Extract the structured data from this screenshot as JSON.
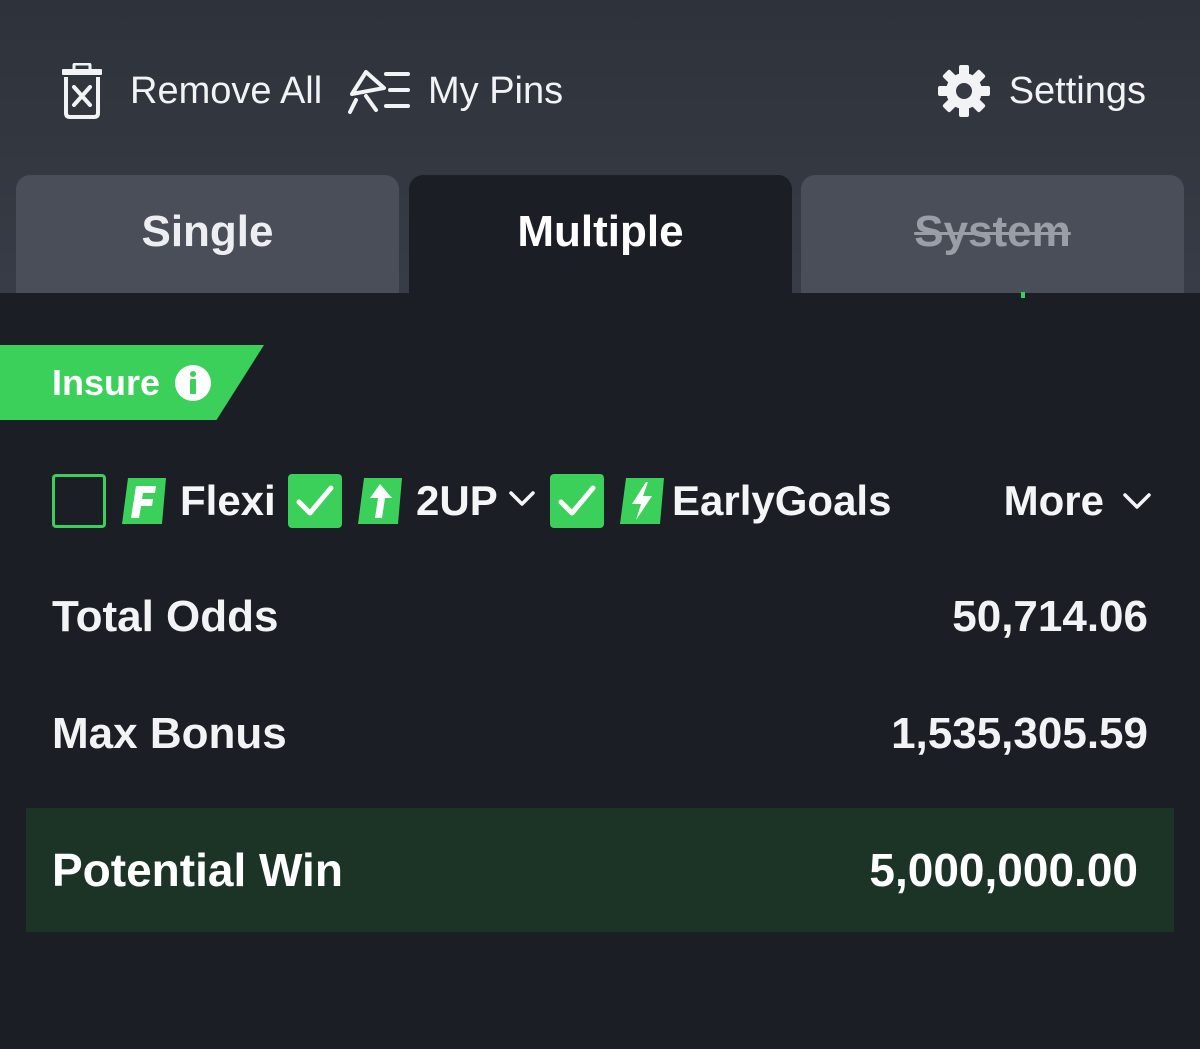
{
  "toolbar": {
    "remove_all_label": "Remove All",
    "my_pins_label": "My Pins",
    "settings_label": "Settings"
  },
  "tabs": [
    {
      "label": "Single",
      "state": "inactive"
    },
    {
      "label": "Multiple",
      "state": "active"
    },
    {
      "label": "System",
      "state": "disabled"
    }
  ],
  "insure": {
    "label": "Insure"
  },
  "options": {
    "flexi": {
      "label": "Flexi",
      "checked": false
    },
    "two_up": {
      "label": "2UP",
      "checked": true
    },
    "early_goals": {
      "label": "EarlyGoals",
      "checked": true
    },
    "more_label": "More"
  },
  "summary": {
    "total_odds_label": "Total Odds",
    "total_odds_value": "50,714.06",
    "max_bonus_label": "Max Bonus",
    "max_bonus_value": "1,535,305.59",
    "potential_win_label": "Potential Win",
    "potential_win_value": "5,000,000.00"
  },
  "colors": {
    "accent": "#3bd05a",
    "background": "#1b1e24",
    "header": "#383c46",
    "tab_inactive": "#4a4e58",
    "potential_win_bg": "#1b3426"
  },
  "icons": {
    "remove_all": "trash-x-icon",
    "my_pins": "pin-list-icon",
    "settings": "gear-icon",
    "info": "info-icon",
    "flexi": "flexi-f-icon",
    "two_up": "two-up-arrow-icon",
    "early_goals": "lightning-icon"
  }
}
